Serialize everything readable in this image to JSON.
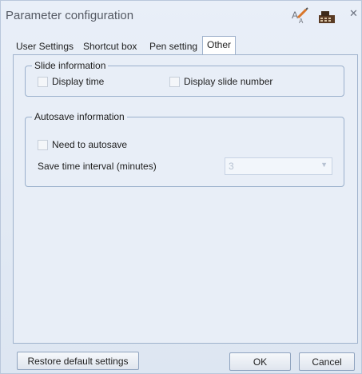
{
  "window": {
    "title": "Parameter configuration",
    "icons": [
      "spellcheck-icon",
      "keyboard-icon",
      "close-icon"
    ]
  },
  "tabs": [
    {
      "label": "User Settings",
      "active": false
    },
    {
      "label": "Shortcut box",
      "active": false
    },
    {
      "label": "Pen setting",
      "active": false
    },
    {
      "label": "Other",
      "active": true
    }
  ],
  "slide_info": {
    "legend": "Slide information",
    "display_time": {
      "label": "Display time",
      "checked": false
    },
    "display_slide_number": {
      "label": "Display slide number",
      "checked": false
    }
  },
  "autosave": {
    "legend": "Autosave information",
    "need_autosave": {
      "label": "Need to autosave",
      "checked": false
    },
    "interval_label": "Save time interval (minutes)",
    "interval_value": "3"
  },
  "buttons": {
    "restore": "Restore default settings",
    "ok": "OK",
    "cancel": "Cancel"
  }
}
